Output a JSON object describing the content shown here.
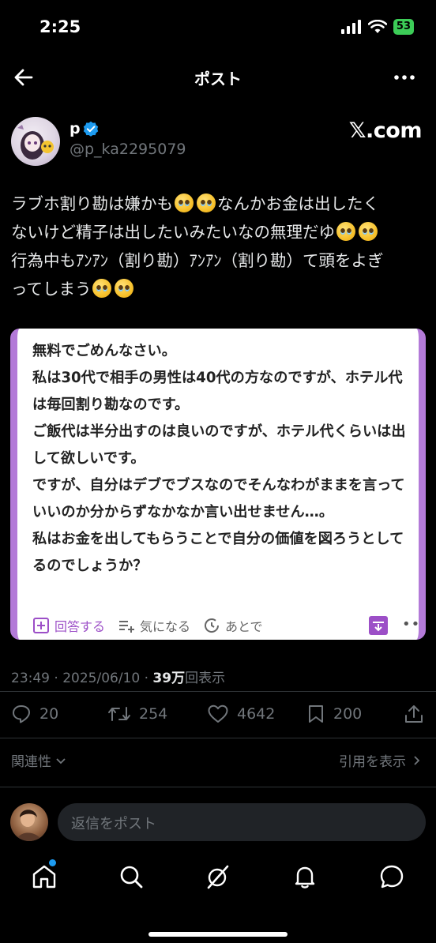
{
  "status": {
    "time": "2:25",
    "battery": "53"
  },
  "header": {
    "title": "ポスト"
  },
  "author": {
    "name": "p",
    "handle": "@p_ka2295079",
    "source_badge": "𝕏.com"
  },
  "tweet": {
    "line1a": "ラブホ割り勘は嫌かも",
    "line1b": "なんかお金は出したく",
    "line2a": "ないけど精子は出したいみたいなの無理だゆ",
    "line3": "行為中もｱﾝｱﾝ（割り勘）ｱﾝｱﾝ（割り勘）て頭をよぎ",
    "line4a": "ってしまう"
  },
  "card": {
    "text": "無料でごめんなさい。\n私は30代で相手の男性は40代の方なのですが、ホテル代は毎回割り勘なのです。\nご飯代は半分出すのは良いのですが、ホテル代くらいは出して欲しいです。\nですが、自分はデブでブスなのでそんなわがままを言っていいのか分からずなかなか言い出せません…。\n私はお金を出してもらうことで自分の価値を図ろうとしてるのでしょうか？",
    "answer_label": "回答する",
    "interest_label": "気になる",
    "later_label": "あとで",
    "more_label": "•••"
  },
  "meta": {
    "time": "23:49 · 2025/06/10 · ",
    "views": "39万",
    "views_suffix": "回表示"
  },
  "stats": {
    "replies": "20",
    "reposts": "254",
    "likes": "4642",
    "bookmarks": "200"
  },
  "relevance_label": "関連性",
  "quotes_label": "引用を表示",
  "reply": {
    "placeholder": "返信をポスト"
  },
  "accent": "#1d9bf0",
  "card_accent": "#9c4fc7"
}
